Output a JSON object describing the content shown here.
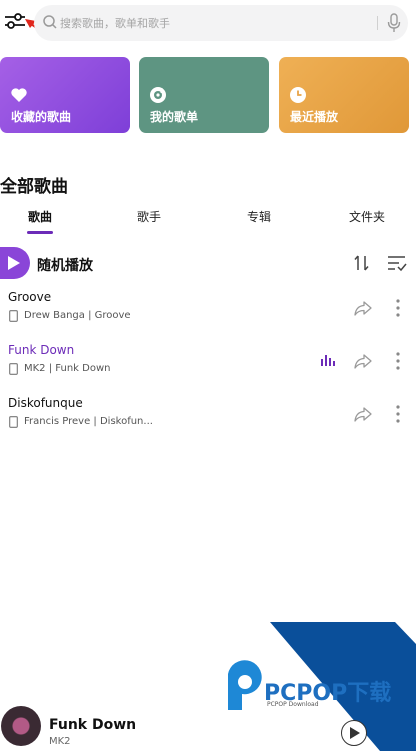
{
  "search": {
    "placeholder": "搜索歌曲，歌单和歌手"
  },
  "cards": [
    {
      "label": "收藏的歌曲",
      "icon": "heart-icon",
      "color": "#8d4fe0"
    },
    {
      "label": "我的歌单",
      "icon": "playlist-disc-icon",
      "color": "#5e9582"
    },
    {
      "label": "最近播放",
      "icon": "clock-icon",
      "color": "#e8a448"
    }
  ],
  "section_title": "全部歌曲",
  "tabs": [
    {
      "label": "歌曲",
      "active": true
    },
    {
      "label": "歌手",
      "active": false
    },
    {
      "label": "专辑",
      "active": false
    },
    {
      "label": "文件夹",
      "active": false
    }
  ],
  "shuffle_label": "随机播放",
  "songs": [
    {
      "title": "Groove",
      "subtitle": "Drew Banga | Groove",
      "playing": false
    },
    {
      "title": "Funk Down",
      "subtitle": "MK2 | Funk Down",
      "playing": true
    },
    {
      "title": "Diskofunque",
      "subtitle": "Francis Preve | Diskofun...",
      "playing": false
    }
  ],
  "watermark": {
    "brand": "PCPOP下载",
    "sub": "PCPOP Download"
  },
  "player": {
    "title": "Funk Down",
    "artist": "MK2"
  },
  "accent_color": "#6c2bb8"
}
